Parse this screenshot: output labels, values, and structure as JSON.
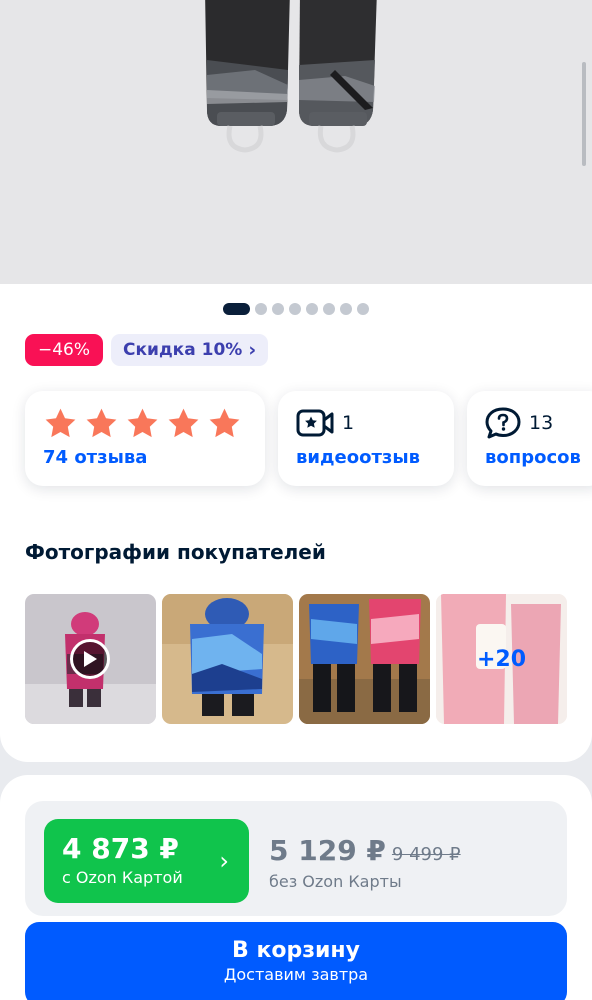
{
  "gallery": {
    "image_count": 9,
    "active_index": 0
  },
  "badges": {
    "sale": "−46%",
    "discount": "Скидка 10%"
  },
  "tiles": {
    "rating": {
      "stars": 5,
      "label": "74 отзыва"
    },
    "video": {
      "count": "1",
      "label": "видеоотзыв"
    },
    "questions": {
      "count": "13",
      "label": "вопросов"
    }
  },
  "photos": {
    "title": "Фотографии покупателей",
    "more_count": "+20"
  },
  "price": {
    "ozon_card_price": "4 873 ₽",
    "ozon_card_label": "с Ozon Картой",
    "regular_price": "5 129 ₽",
    "old_price": "9 499 ₽",
    "regular_label": "без Ozon Карты"
  },
  "cart": {
    "button_label": "В корзину",
    "delivery": "Доставим завтра"
  },
  "colors": {
    "accent_blue": "#005bff",
    "sale_red": "#f91155",
    "ozon_green": "#10c44c",
    "star": "#f9775a"
  }
}
